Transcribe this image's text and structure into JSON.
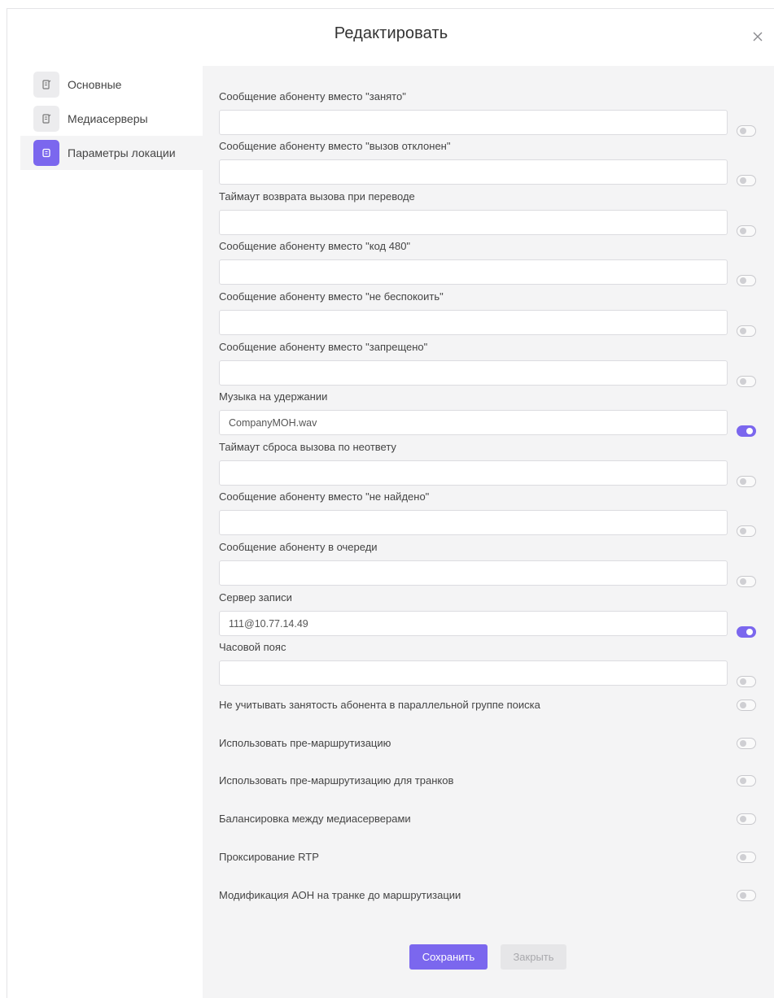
{
  "modal": {
    "title": "Редактировать"
  },
  "sidebar": {
    "items": [
      {
        "label": "Основные",
        "icon": "document-icon",
        "active": false
      },
      {
        "label": "Медиасерверы",
        "icon": "document-icon",
        "active": false
      },
      {
        "label": "Параметры локации",
        "icon": "document-icon",
        "active": true
      }
    ]
  },
  "fields": [
    {
      "label": "Сообщение абоненту вместо \"занято\"",
      "value": "",
      "enabled": false
    },
    {
      "label": "Сообщение абоненту вместо \"вызов отклонен\"",
      "value": "",
      "enabled": false
    },
    {
      "label": "Таймаут возврата вызова при переводе",
      "value": "",
      "enabled": false
    },
    {
      "label": "Сообщение абоненту вместо \"код 480\"",
      "value": "",
      "enabled": false
    },
    {
      "label": "Сообщение абоненту вместо \"не беспокоить\"",
      "value": "",
      "enabled": false
    },
    {
      "label": "Сообщение абоненту вместо \"запрещено\"",
      "value": "",
      "enabled": false
    },
    {
      "label": "Музыка на удержании",
      "value": "CompanyMOH.wav",
      "enabled": true
    },
    {
      "label": "Таймаут сброса вызова по неответу",
      "value": "",
      "enabled": false
    },
    {
      "label": "Сообщение абоненту вместо \"не найдено\"",
      "value": "",
      "enabled": false
    },
    {
      "label": "Сообщение абоненту в очереди",
      "value": "",
      "enabled": false
    },
    {
      "label": "Сервер записи",
      "value": "111@10.77.14.49",
      "enabled": true
    },
    {
      "label": "Часовой пояс",
      "value": "",
      "enabled": false
    }
  ],
  "switches": [
    {
      "label": "Не учитывать занятость абонента в параллельной группе поиска",
      "enabled": false
    },
    {
      "label": "Использовать пре-маршрутизацию",
      "enabled": false
    },
    {
      "label": "Использовать пре-маршрутизацию для транков",
      "enabled": false
    },
    {
      "label": "Балансировка между медиасерверами",
      "enabled": false
    },
    {
      "label": "Проксирование RTP",
      "enabled": false
    },
    {
      "label": "Модификация АОН на транке до маршрутизации",
      "enabled": false
    }
  ],
  "footer": {
    "save_label": "Сохранить",
    "close_label": "Закрыть"
  },
  "colors": {
    "accent": "#7b67ee",
    "panel_bg": "#f4f4f5"
  }
}
